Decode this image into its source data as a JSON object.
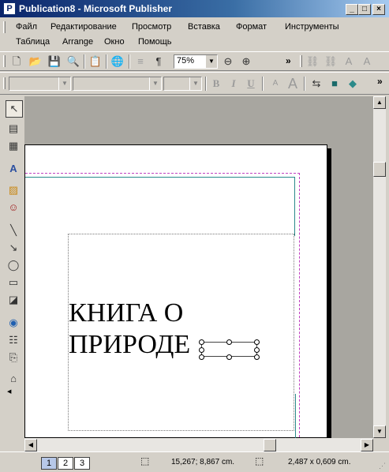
{
  "window": {
    "app_icon_glyph": "P",
    "title": "Publication8 - Microsoft Publisher",
    "buttons": {
      "minimize": "_",
      "maximize": "□",
      "close": "×"
    }
  },
  "menu": {
    "row1": [
      "Файл",
      "Редактирование",
      "Просмотр",
      "Вставка",
      "Формат",
      "Инструменты"
    ],
    "row2": [
      "Таблица",
      "Arrange",
      "Окно",
      "Помощь"
    ]
  },
  "standard_toolbar": {
    "zoom_value": "75%",
    "overflow_glyph": "»"
  },
  "format_toolbar": {
    "style_value": "",
    "font_value": "",
    "size_value": "",
    "bold_glyph": "B",
    "italic_glyph": "I",
    "underline_glyph": "U",
    "overflow_glyph": "»"
  },
  "document": {
    "text_line1": "КНИГА О",
    "text_line2": "ПРИРОДЕ"
  },
  "status": {
    "pages": [
      "1",
      "2",
      "3"
    ],
    "current_page": "1",
    "position": "15,267; 8,867 cm.",
    "size": "2,487 x  0,609 cm."
  },
  "colors": {
    "title_gradient_start": "#0a246a",
    "title_gradient_end": "#a6caf0",
    "chrome": "#d4d0c8",
    "workspace": "#a8a6a0",
    "margin_guide": "#c040c0",
    "column_guide": "#2a8a8a"
  }
}
